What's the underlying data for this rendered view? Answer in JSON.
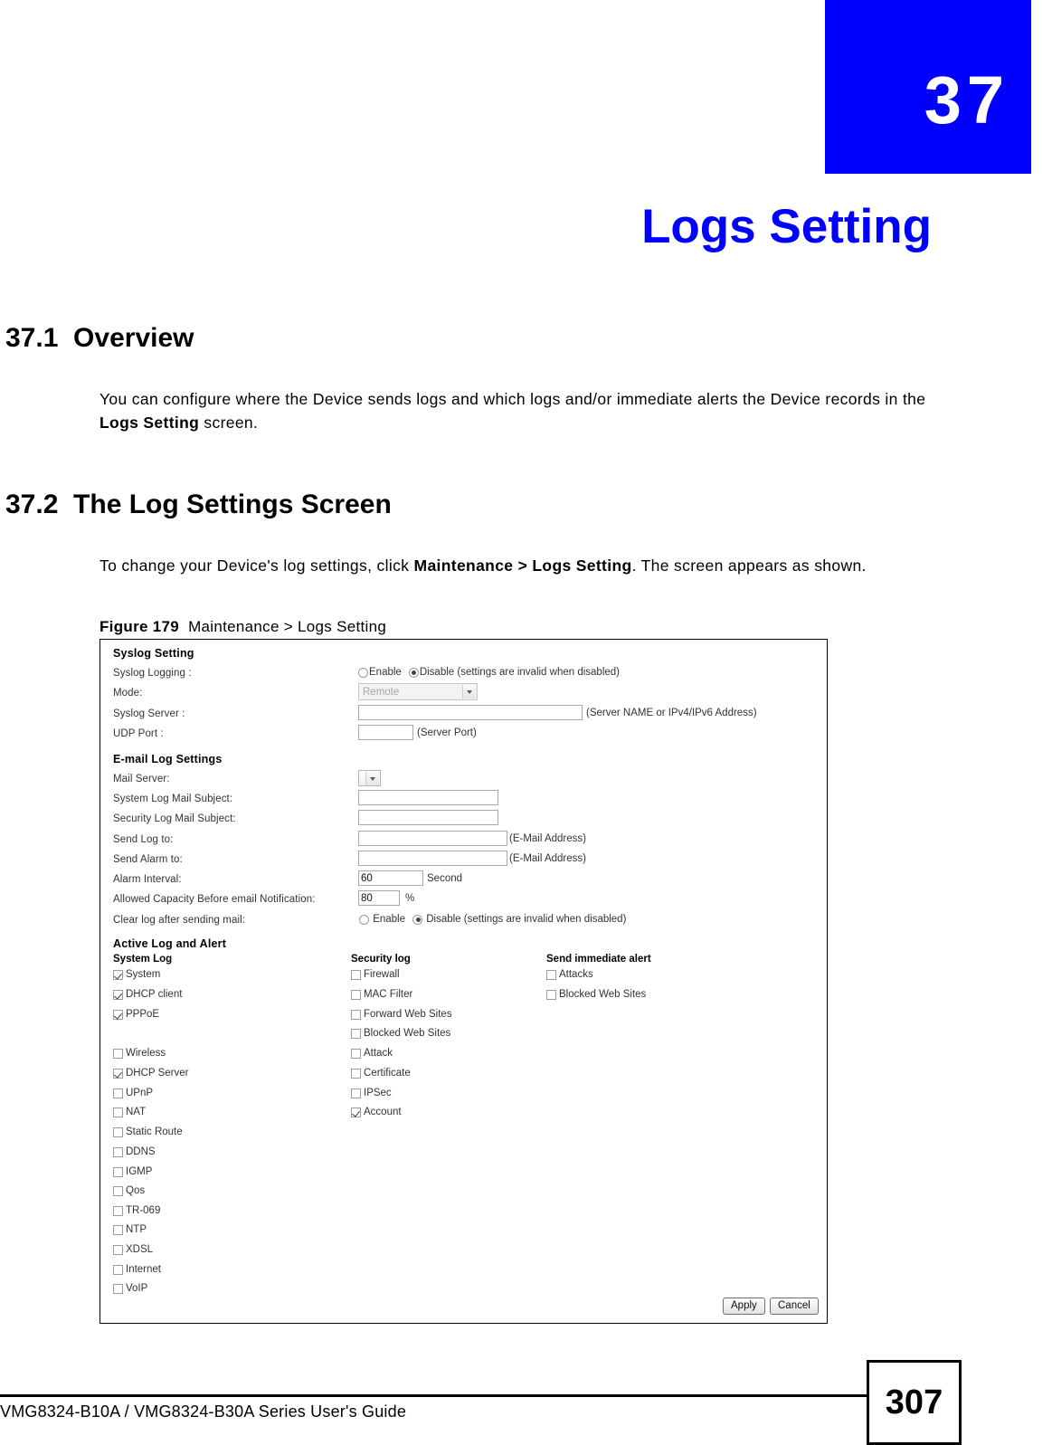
{
  "chapter": {
    "number": "37",
    "title": "Logs Setting"
  },
  "sections": [
    {
      "heading": "37.1  Overview",
      "body_prefix": "You can configure where the Device sends logs and which logs and/or immediate alerts the Device records in the ",
      "body_bold": "Logs Setting",
      "body_suffix": " screen."
    },
    {
      "heading": "37.2  The Log Settings Screen",
      "body_prefix": "To change your Device's log settings, click ",
      "body_bold": "Maintenance >  Logs Setting",
      "body_suffix": ". The screen appears as shown."
    }
  ],
  "figure": {
    "label": "Figure 179",
    "caption": "Maintenance >  Logs Setting"
  },
  "screen": {
    "syslog": {
      "group_title": "Syslog Setting",
      "logging_label": "Syslog Logging :",
      "enable_label": "Enable",
      "disable_label": "Disable",
      "disabled_hint": "(settings are invalid when disabled)",
      "logging_value": "Disable",
      "mode_label": "Mode:",
      "mode_value": "Remote",
      "server_label": "Syslog Server :",
      "server_value": "",
      "server_hint": "(Server NAME or IPv4/IPv6 Address)",
      "udp_label": "UDP Port :",
      "udp_value": "",
      "udp_hint": "(Server Port)"
    },
    "email": {
      "group_title": "E-mail Log Settings",
      "mail_server_label": "Mail Server:",
      "mail_server_value": "",
      "system_subject_label": "System Log Mail Subject:",
      "system_subject_value": "",
      "security_subject_label": "Security Log Mail Subject:",
      "security_subject_value": "",
      "send_log_label": "Send Log to:",
      "send_log_value": "",
      "send_log_hint": "(E-Mail Address)",
      "send_alarm_label": "Send Alarm to:",
      "send_alarm_value": "",
      "send_alarm_hint": "(E-Mail Address)",
      "alarm_interval_label": "Alarm Interval:",
      "alarm_interval_value": "60",
      "alarm_interval_unit": "Second",
      "capacity_label": "Allowed Capacity Before email Notification:",
      "capacity_value": "80",
      "capacity_unit": "%",
      "clear_log_label": "Clear log after sending mail:",
      "clear_enable_label": "Enable",
      "clear_disable_label": "Disable",
      "clear_hint": "(settings are invalid when disabled)",
      "clear_log_value": "Disable"
    },
    "active": {
      "group_title": "Active Log and Alert",
      "columns": [
        {
          "header": "System Log",
          "items": [
            {
              "label": "System",
              "checked": true
            },
            {
              "label": "DHCP client",
              "checked": true
            },
            {
              "label": "PPPoE",
              "checked": true
            },
            {
              "label": "Wireless",
              "checked": false
            },
            {
              "label": "DHCP Server",
              "checked": true
            },
            {
              "label": "UPnP",
              "checked": false
            },
            {
              "label": "NAT",
              "checked": false
            },
            {
              "label": "Static Route",
              "checked": false
            },
            {
              "label": "DDNS",
              "checked": false
            },
            {
              "label": "IGMP",
              "checked": false
            },
            {
              "label": "Qos",
              "checked": false
            },
            {
              "label": "TR-069",
              "checked": false
            },
            {
              "label": "NTP",
              "checked": false
            },
            {
              "label": "XDSL",
              "checked": false
            },
            {
              "label": "Internet",
              "checked": false
            },
            {
              "label": "VoIP",
              "checked": false
            }
          ]
        },
        {
          "header": "Security log",
          "items": [
            {
              "label": "Firewall",
              "checked": false
            },
            {
              "label": "MAC Filter",
              "checked": false
            },
            {
              "label": "Forward Web Sites",
              "checked": false
            },
            {
              "label": "Blocked Web Sites",
              "checked": false
            },
            {
              "label": "Attack",
              "checked": false
            },
            {
              "label": "Certificate",
              "checked": false
            },
            {
              "label": "IPSec",
              "checked": false
            },
            {
              "label": "Account",
              "checked": true
            }
          ]
        },
        {
          "header": "Send immediate alert",
          "items": [
            {
              "label": "Attacks",
              "checked": false
            },
            {
              "label": "Blocked Web Sites",
              "checked": false
            }
          ]
        }
      ]
    },
    "buttons": {
      "apply": "Apply",
      "cancel": "Cancel"
    }
  },
  "footer": {
    "guide": "VMG8324-B10A / VMG8324-B30A Series User's Guide",
    "page": "307"
  },
  "colors": {
    "accent": "#0000ff",
    "text": "#000000"
  }
}
